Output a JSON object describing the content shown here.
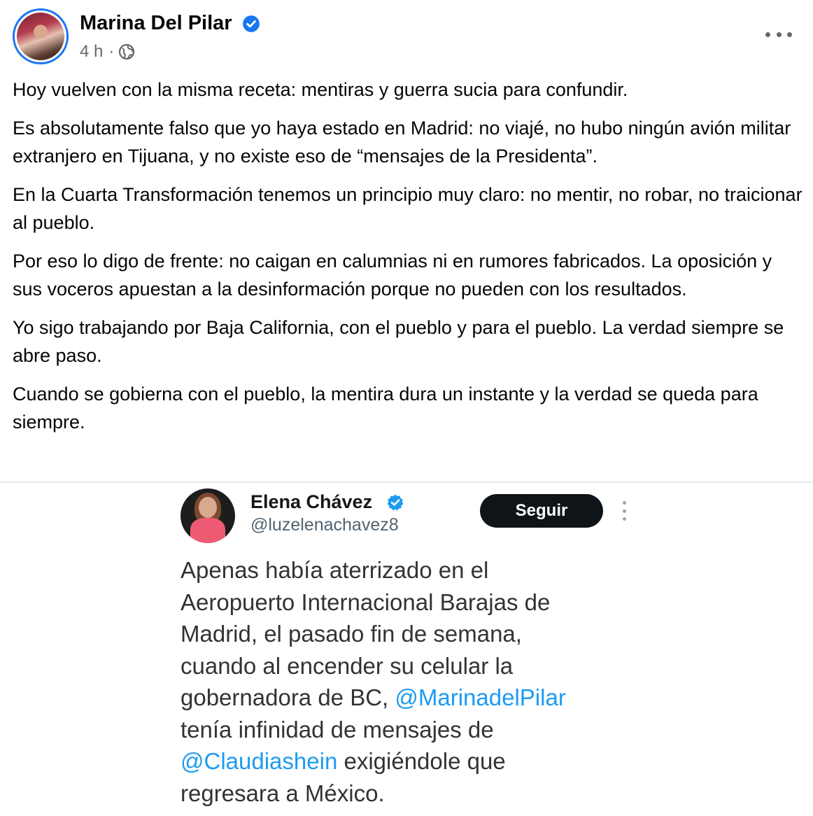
{
  "post": {
    "author": "Marina Del Pilar",
    "time": "4 h",
    "separator": "·",
    "paragraphs": [
      "Hoy vuelven con la misma receta: mentiras y guerra sucia para confundir.",
      "Es absolutamente falso que yo haya estado en Madrid: no viajé, no hubo ningún avión militar extranjero en Tijuana, y no existe eso de “mensajes de la Presidenta”.",
      "En la Cuarta Transformación tenemos un principio muy claro: no mentir, no robar, no traicionar al pueblo.",
      "Por eso lo digo de frente: no caigan en calumnias ni en rumores fabricados. La oposición y sus voceros apuestan a la desinformación porque no pueden con los resultados.",
      "Yo sigo trabajando por Baja California, con el pueblo y para el pueblo. La verdad siempre se abre paso.",
      "Cuando se gobierna con el pueblo, la mentira dura un instante y la verdad se queda para siempre."
    ]
  },
  "embedded_tweet": {
    "name": "Elena Chávez",
    "handle": "@luzelenachavez8",
    "follow_label": "Seguir",
    "lines": {
      "l1": "Apenas había aterrizado en el",
      "l2": "Aeropuerto Internacional Barajas de",
      "l3": "Madrid, el pasado fin de semana,",
      "l4": "cuando al encender su celular la",
      "l5_text": "gobernadora de BC, ",
      "l5_mention": "@MarinadelPilar",
      "l6": "tenía infinidad de mensajes de",
      "l7_mention": "@Claudiashein",
      "l7_text": " exigiéndole que",
      "l8": "regresara a México."
    }
  },
  "colors": {
    "facebook_blue": "#1877f2",
    "secondary_text": "#65676b",
    "twitter_blue": "#1d9bf0",
    "follow_bg": "#0f1419"
  },
  "icons": {
    "verified": "verified-badge-icon",
    "privacy": "globe-icon",
    "more": "more-options-icon"
  }
}
